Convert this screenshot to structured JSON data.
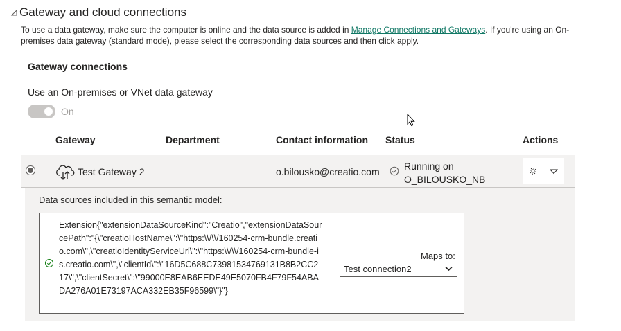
{
  "section": {
    "title": "Gateway and cloud connections",
    "description_before": "To use a data gateway, make sure the computer is online and the data source is added in ",
    "description_link": "Manage Connections and Gateways",
    "description_after": ". If you're using an On-premises data gateway (standard mode), please select the corresponding data sources and then click apply."
  },
  "gateway_connections": {
    "heading": "Gateway connections",
    "toggle_label": "Use an On-premises or VNet data gateway",
    "toggle_state": "On",
    "toggle_on": true
  },
  "table": {
    "headers": {
      "gateway": "Gateway",
      "department": "Department",
      "contact": "Contact information",
      "status": "Status",
      "actions": "Actions"
    },
    "row": {
      "gateway": "Test Gateway 2",
      "department": "",
      "contact": "o.bilousko@creatio.com",
      "status_line1": "Running on",
      "status_line2": "O_BILOUSKO_NB"
    }
  },
  "data_sources": {
    "label": "Data sources included in this semantic model:",
    "source_text": "Extension{\"extensionDataSourceKind\":\"Creatio\",\"extensionDataSourcePath\":\"{\\\"creatioHostName\\\":\\\"https:\\\\/\\\\/160254-crm-bundle.creatio.com\\\",\\\"creatioIdentityServiceUrl\\\":\\\"https:\\\\/\\\\/160254-crm-bundle-is.creatio.com\\\",\\\"clientId\\\":\\\"16D5C688C73981534769131B8B2CC217\\\",\\\"clientSecret\\\":\\\"99000E8EAB6EEDE49E5070FB4F79F54ABADA276A01E73197ACA332EB35F96599\\\"}\"}",
    "maps_to_label": "Maps to:",
    "maps_to_value": "Test connection2"
  },
  "colors": {
    "accent": "#117865",
    "row_bg": "#f3f2f1",
    "check": "#107c10"
  }
}
